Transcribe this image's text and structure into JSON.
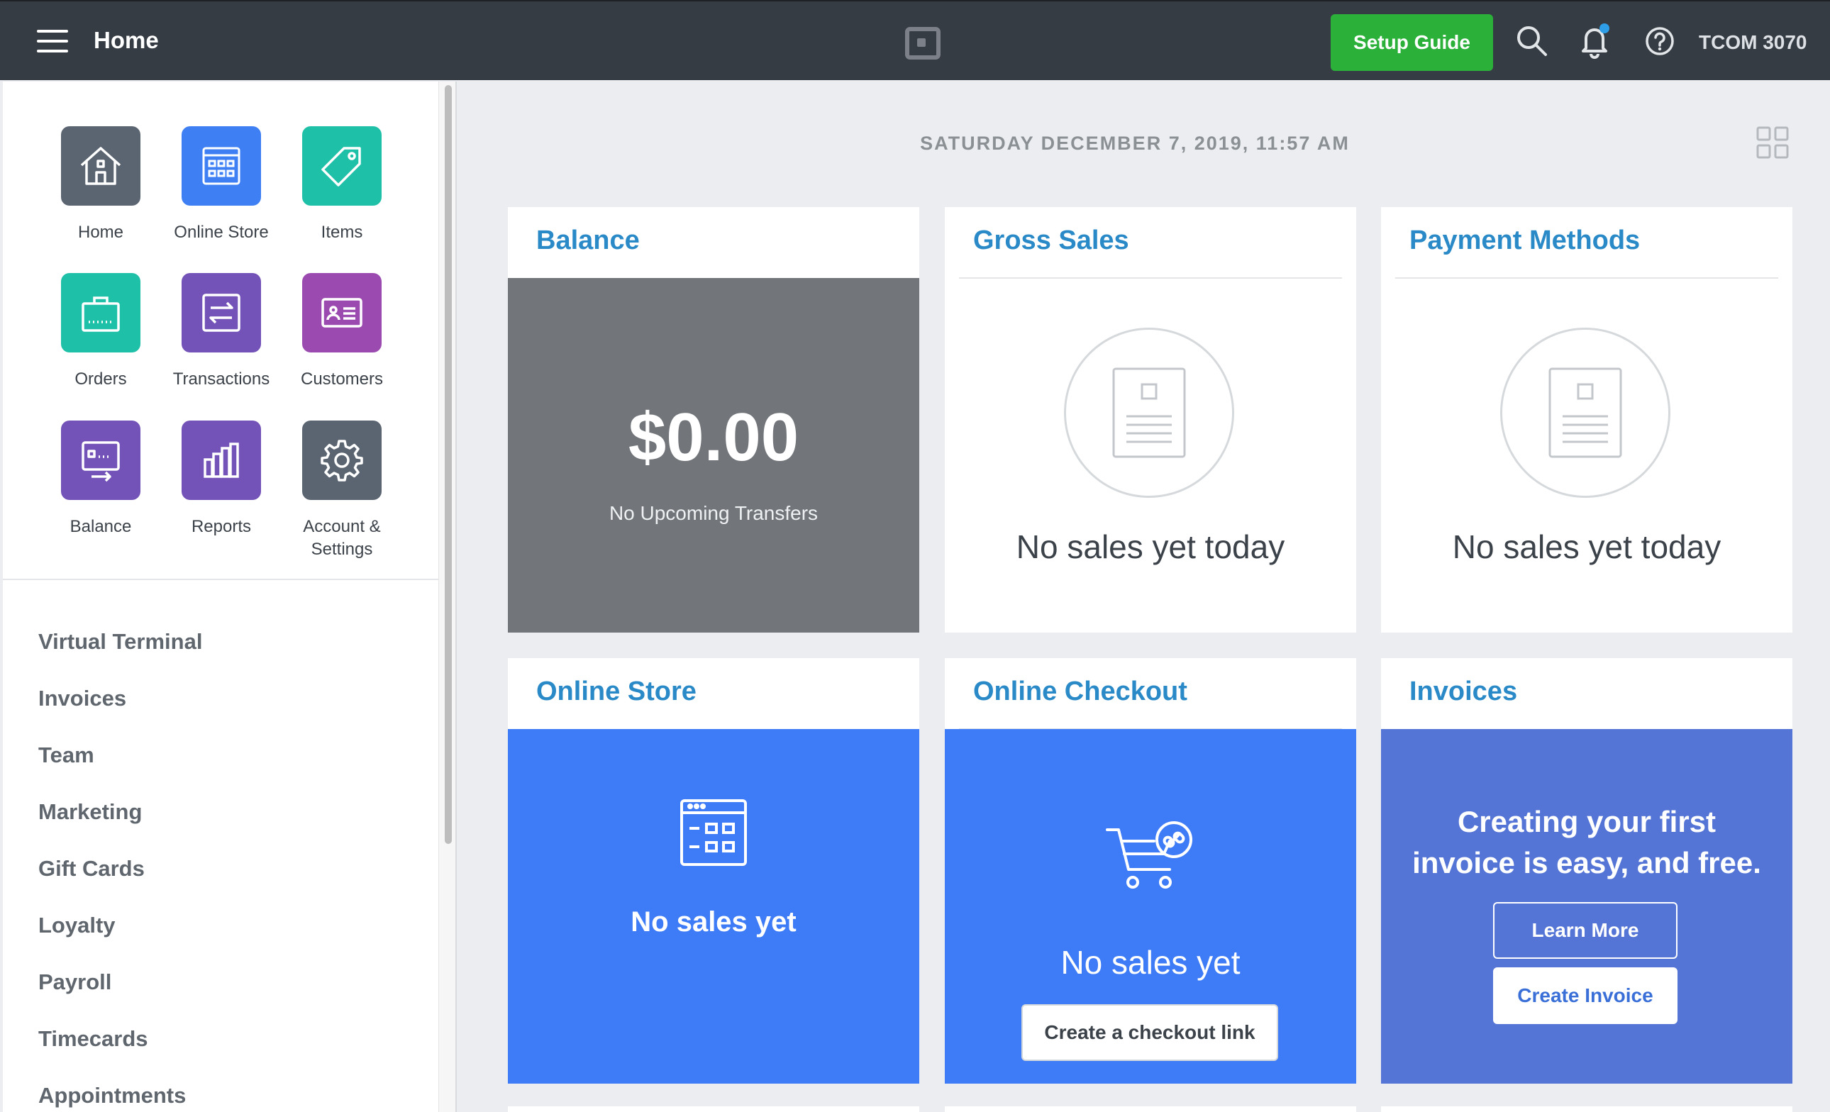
{
  "topbar": {
    "title": "Home",
    "setup_guide": "Setup Guide",
    "account": "TCOM 3070",
    "icons": [
      "menu-icon",
      "square-logo-icon",
      "search-icon",
      "bell-icon",
      "help-icon"
    ]
  },
  "apps": [
    {
      "label": "Home",
      "icon": "home-icon",
      "color": "#5b6571"
    },
    {
      "label": "Online Store",
      "icon": "online-store-icon",
      "color": "#3e80f4"
    },
    {
      "label": "Items",
      "icon": "tag-icon",
      "color": "#1fc0a8"
    },
    {
      "label": "Orders",
      "icon": "shopping-bag-icon",
      "color": "#1fc0a8"
    },
    {
      "label": "Transactions",
      "icon": "transactions-icon",
      "color": "#7453b8"
    },
    {
      "label": "Customers",
      "icon": "customers-icon",
      "color": "#9b4bb0"
    },
    {
      "label": "Balance",
      "icon": "balance-icon",
      "color": "#7453b8"
    },
    {
      "label": "Reports",
      "icon": "reports-icon",
      "color": "#7453b8"
    },
    {
      "label_line1": "Account &",
      "label_line2": "Settings",
      "icon": "gear-icon",
      "color": "#5b6571"
    }
  ],
  "nav": [
    "Virtual Terminal",
    "Invoices",
    "Team",
    "Marketing",
    "Gift Cards",
    "Loyalty",
    "Payroll",
    "Timecards",
    "Appointments"
  ],
  "date": "SATURDAY DECEMBER 7, 2019, 11:57 AM",
  "cards": {
    "balance": {
      "title": "Balance",
      "amount": "$0.00",
      "subtitle": "No Upcoming Transfers"
    },
    "gross_sales": {
      "title": "Gross Sales",
      "empty": "No sales yet today"
    },
    "payment_methods": {
      "title": "Payment Methods",
      "empty": "No sales yet today"
    },
    "online_store": {
      "title": "Online Store",
      "empty": "No sales yet"
    },
    "online_checkout": {
      "title": "Online Checkout",
      "empty": "No sales yet",
      "button": "Create a checkout link"
    },
    "invoices": {
      "title": "Invoices",
      "message_line1": "Creating your first",
      "message_line2": "invoice is easy, and free.",
      "learn_more": "Learn More",
      "create": "Create Invoice"
    }
  },
  "colors": {
    "topbar": "#363c44",
    "setup_green": "#2bb13a",
    "title_blue": "#2a89c7",
    "store_blue": "#3e7bf7",
    "invoice_blue": "#5575d6",
    "balance_gray": "#72767b"
  }
}
